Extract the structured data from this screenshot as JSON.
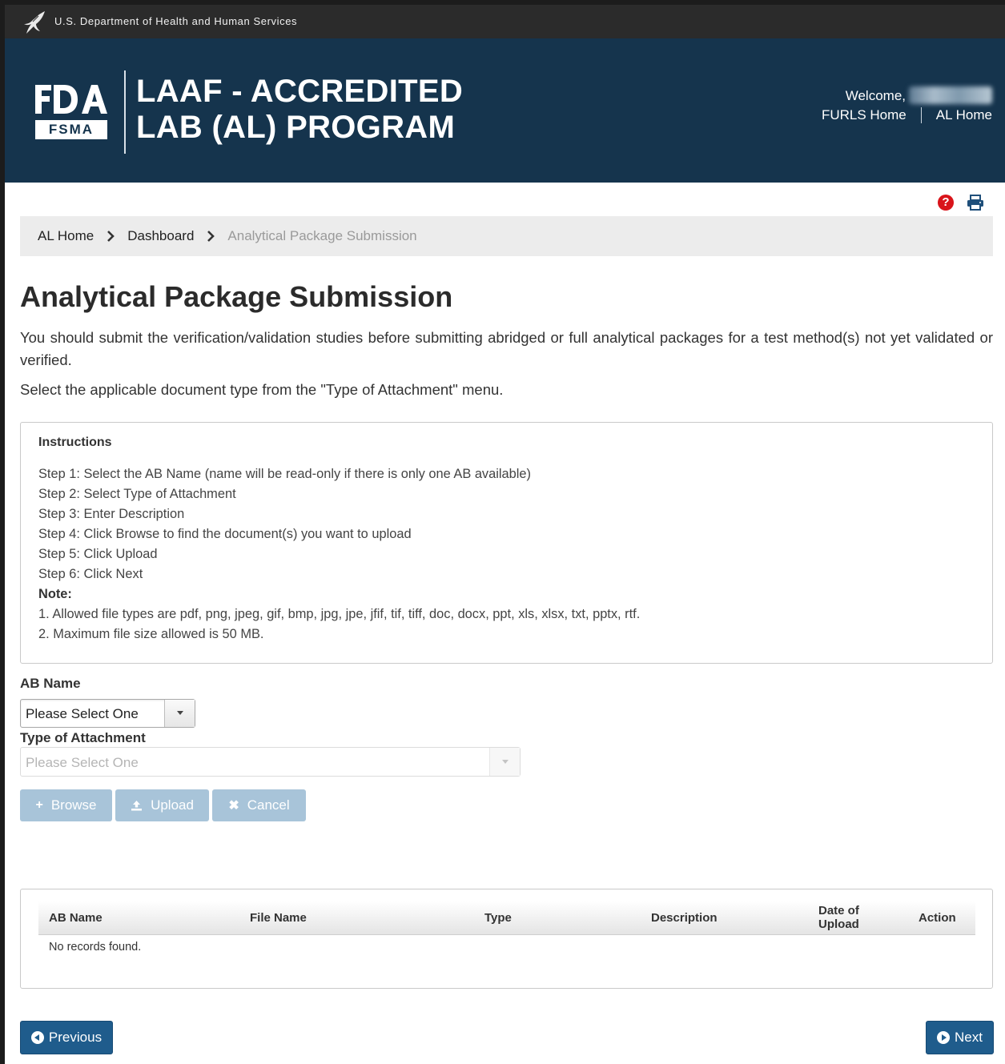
{
  "hhs_bar": {
    "text": "U.S. Department of Health and Human Services"
  },
  "header": {
    "fsma_label": "FSMA",
    "title_line1": "LAAF - ACCREDITED",
    "title_line2": "LAB (AL) PROGRAM",
    "welcome": "Welcome,",
    "links": [
      "FURLS Home",
      "AL Home"
    ]
  },
  "breadcrumb": {
    "items": [
      "AL Home",
      "Dashboard"
    ],
    "current": "Analytical Package Submission"
  },
  "page": {
    "title": "Analytical Package Submission",
    "intro": "You should submit the verification/validation studies before submitting abridged or full analytical packages for a test method(s) not yet validated or verified.",
    "intro2": "Select the applicable document type from the \"Type of Attachment\" menu."
  },
  "instructions": {
    "heading": "Instructions",
    "steps": [
      "Step 1: Select the AB Name (name will be read-only if there is only one AB available)",
      "Step 2: Select Type of Attachment",
      "Step 3: Enter Description",
      "Step 4: Click Browse to find the document(s) you want to upload",
      "Step 5: Click Upload",
      "Step 6: Click Next"
    ],
    "note_label": "Note:",
    "notes": [
      "1. Allowed file types are pdf, png, jpeg, gif, bmp, jpg, jpe, jfif, tif, tiff, doc, docx, ppt, xls, xlsx, txt, pptx, rtf.",
      "2. Maximum file size allowed is 50 MB."
    ]
  },
  "form": {
    "ab_name_label": "AB Name",
    "ab_name_value": "Please Select One",
    "attachment_label": "Type of Attachment",
    "attachment_value": "Please Select One",
    "browse": "Browse",
    "upload": "Upload",
    "cancel": "Cancel"
  },
  "table": {
    "columns": [
      "AB Name",
      "File Name",
      "Type",
      "Description",
      "Date of Upload",
      "Action"
    ],
    "date_col_line1": "Date of",
    "date_col_line2": "Upload",
    "empty": "No records found."
  },
  "nav": {
    "previous": "Previous",
    "next": "Next"
  },
  "colors": {
    "header_bg": "#15344d",
    "primary_button": "#1f5c8c",
    "disabled_button": "#a8c4d9",
    "help_red": "#d9141a"
  }
}
